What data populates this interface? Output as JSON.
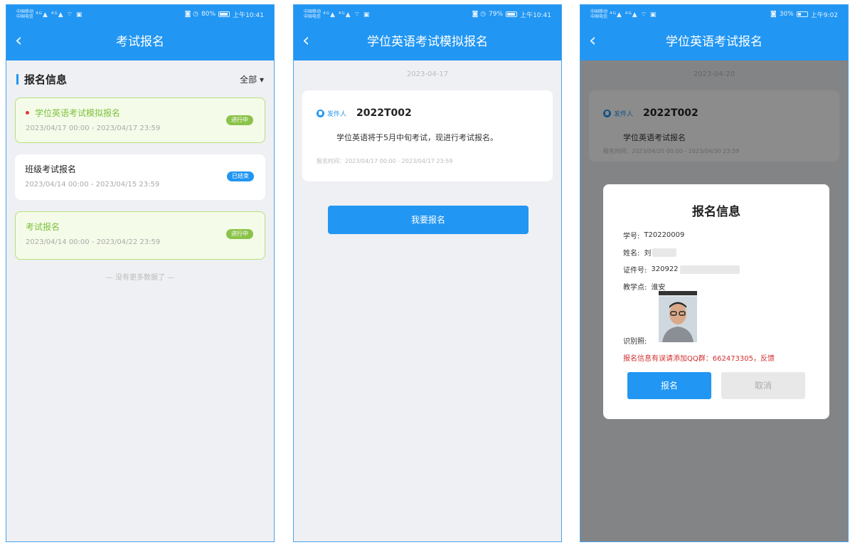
{
  "status_bar": [
    {
      "carrier": "中国移动\n中国电信",
      "signal": "⁴ᴳ▲ ⁴ᴳ▲ ⌔ ▣",
      "indicators": "◙ ◷",
      "battery_label": "80%",
      "battery_level": 0.8,
      "time": "上午10:41"
    },
    {
      "carrier": "中国移动\n中国电信",
      "signal": "⁴ᴳ▲ ⁴ᴳ▲ ⌔ ▣",
      "indicators": "◙ ◷",
      "battery_label": "79%",
      "battery_level": 0.79,
      "time": "上午10:41"
    },
    {
      "carrier": "中国移动\n中国电信",
      "signal": "⁴ᴳ▲ ⁴ᴳ▲ ⌔ ▣",
      "indicators": "◙",
      "battery_label": "30%",
      "battery_level": 0.3,
      "time": "上午9:02"
    }
  ],
  "screen1": {
    "title": "考试报名",
    "section_title": "报名信息",
    "filter_label": "全部 ▾",
    "items": [
      {
        "title": "学位英语考试模拟报名",
        "time": "2023/04/17 00:00 - 2023/04/17 23:59",
        "status": "进行中"
      },
      {
        "title": "班级考试报名",
        "time": "2023/04/14 00:00 - 2023/04/15 23:59",
        "status": "已结束"
      },
      {
        "title": "考试报名",
        "time": "2023/04/14 00:00 - 2023/04/22 23:59",
        "status": "进行中"
      }
    ],
    "no_more": "— 没有更多数据了 —"
  },
  "screen2": {
    "title": "学位英语考试模拟报名",
    "date": "2023-04-17",
    "sender_label": "发件人",
    "sender_id": "2022T002",
    "body": "学位英语将于5月中旬考试，现进行考试报名。",
    "time_range": "报名时间：2023/04/17 00:00 - 2023/04/17 23:59",
    "button": "我要报名"
  },
  "screen3": {
    "title": "学位英语考试报名",
    "date": "2023-04-20",
    "sender_label": "发件人",
    "sender_id": "2022T002",
    "body": "学位英语考试报名",
    "time_range": "报名时间：2023/04/20 00:00 - 2023/04/30 23:59",
    "modal": {
      "title": "报名信息",
      "student_no_label": "学号:",
      "student_no": "T20220009",
      "name_label": "姓名:",
      "name": "刘",
      "id_label": "证件号:",
      "id_no": "320922",
      "center_label": "教学点:",
      "center": "淮安",
      "photo_label": "识别照:",
      "warning": "报名信息有误请添加QQ群：662473305，反馈",
      "confirm": "报名",
      "cancel": "取消"
    }
  },
  "colors": {
    "primary": "#2196f3",
    "active_green": "#8bc34a",
    "warning_red": "#d32f2f"
  }
}
